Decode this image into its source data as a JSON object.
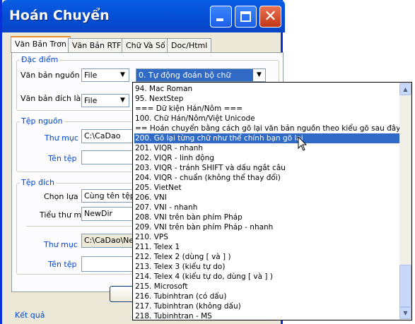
{
  "window": {
    "title": "Hoán Chuyển"
  },
  "tabs": [
    {
      "label": "Văn Bản Trơn"
    },
    {
      "label": "Văn Bản RTF"
    },
    {
      "label": "Chữ Và Số"
    },
    {
      "label": "Doc/Html"
    }
  ],
  "features": {
    "group_title": "Đặc điểm",
    "source_text_label": "Văn bản nguồn",
    "source_format": "File",
    "encoding_selected": "0. Tự động đoán bộ chữ",
    "target_text_label": "Văn bản đích là",
    "target_format": "File"
  },
  "source_file": {
    "group_title": "Tệp nguồn",
    "folder_label": "Thư mục",
    "folder_value": "C:\\CaDao",
    "filename_label": "Tên tệp",
    "filename_value": ""
  },
  "target_file": {
    "group_title": "Tệp đích",
    "option_label": "Chọn lựa",
    "option_value": "Cùng tên tệp, k",
    "subfolder_label": "Tiểu thư mục",
    "subfolder_value": "NewDir",
    "folder_label": "Thư mục",
    "folder_value": "C:\\CaDao\\NewD",
    "filename_label": "Tên tệp",
    "filename_value": ""
  },
  "result": {
    "label": "Kết quả"
  },
  "dropdown": {
    "items": [
      "94. Mac Roman",
      "95. NextStep",
      "=== Dữ kiện Hán/Nôm ===",
      "100. Chữ Hán/Nôm/Việt Unicode",
      "== Hoán chuyển bằng cách gõ lại văn bản nguồn theo kiểu gõ sau đây ===",
      "200. Gõ lại từng chữ như thể chính bạn gõ lại",
      "201. VIQR - nhanh",
      "202. VIQR - linh động",
      "203. VIQR - tránh SHIFT và dấu ngắt câu",
      "204. VIQR - chuẩn (không thể thay đổi)",
      "205. VietNet",
      "206. VNI",
      "207. VNI - nhanh",
      "208. VNI trên bàn phím Pháp",
      "209. VNI trên bàn phím Pháp - nhanh",
      "210. VPS",
      "211. Telex 1",
      "212. Telex 2 (dùng [ và ] )",
      "213. Telex 3 (kiểu tự do)",
      "214. Telex 4 (kiểu tự do, dùng [ và ] )",
      "215. Microsoft",
      "216. Tubinhtran (có dấu)",
      "217. Tubinhtran (không dấu)",
      "218. Tubinhtran - MS"
    ],
    "highlighted_index": 5
  }
}
